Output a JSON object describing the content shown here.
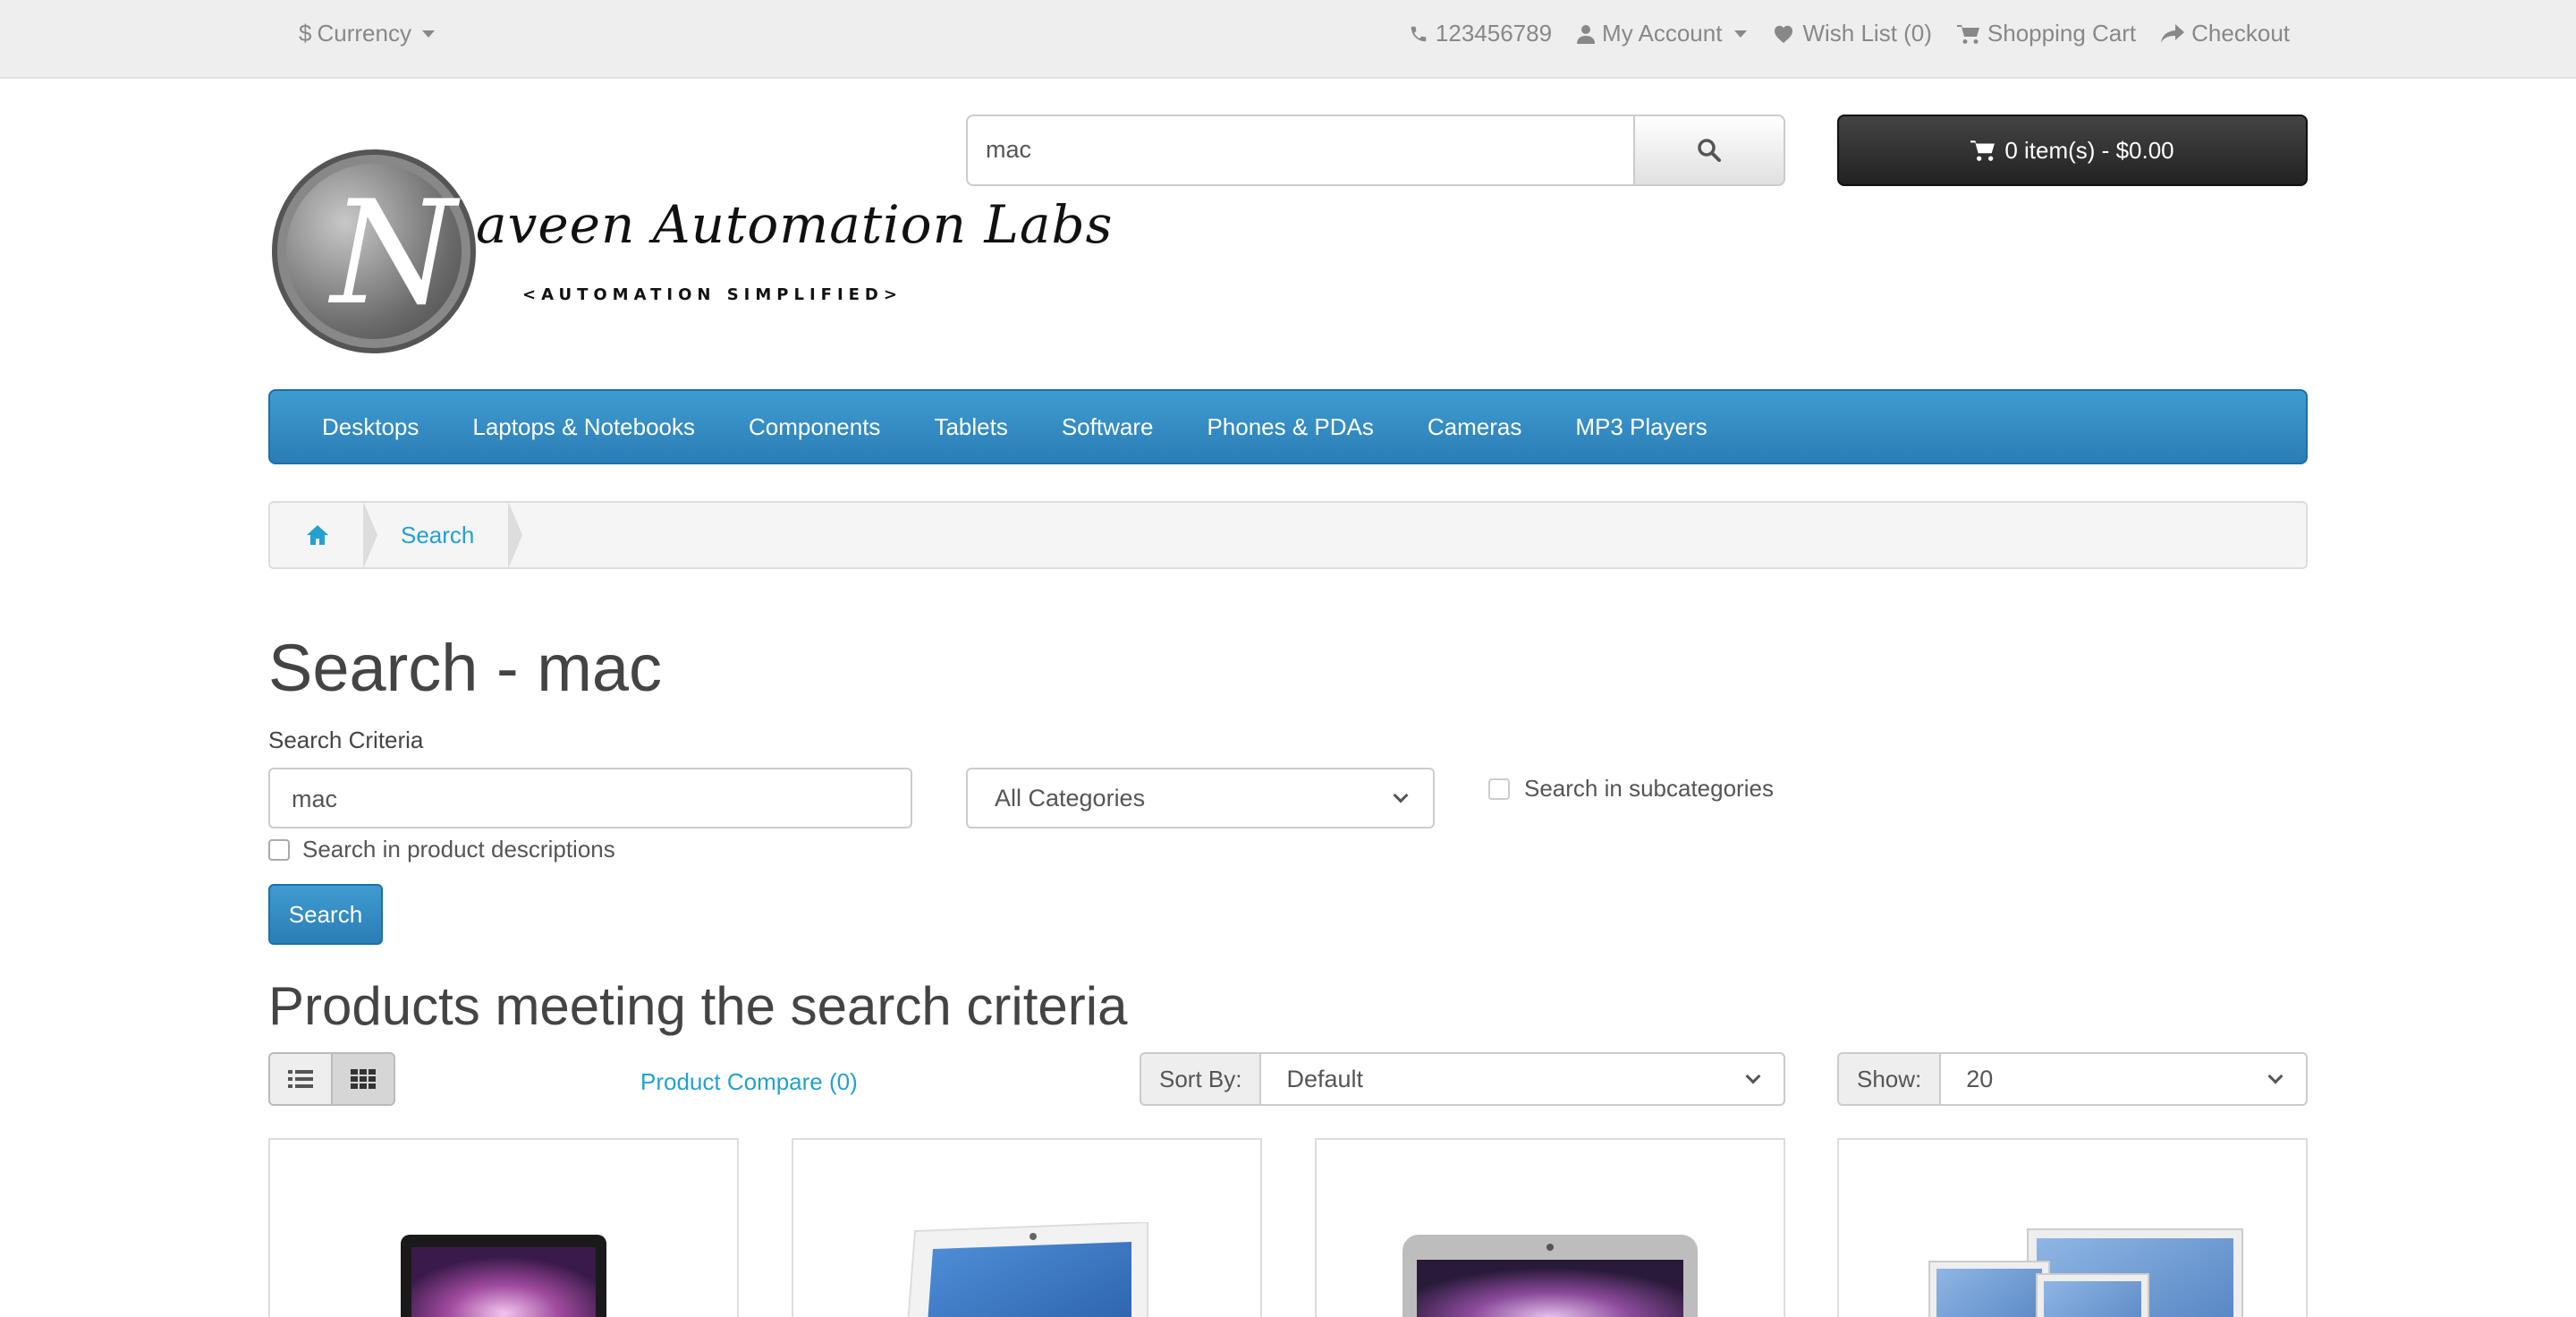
{
  "topbar": {
    "currency_label": "Currency",
    "phone": "123456789",
    "my_account": "My Account",
    "wish_list": "Wish List (0)",
    "shopping_cart": "Shopping Cart",
    "checkout": "Checkout"
  },
  "logo": {
    "wordmark": "aveen Automation Labs",
    "tagline": "<AUTOMATION SIMPLIFIED>",
    "initial": "N"
  },
  "header_search": {
    "value": "mac"
  },
  "cart": {
    "label": "0 item(s) - $0.00"
  },
  "menu": {
    "items": [
      "Desktops",
      "Laptops & Notebooks",
      "Components",
      "Tablets",
      "Software",
      "Phones & PDAs",
      "Cameras",
      "MP3 Players"
    ]
  },
  "breadcrumb": {
    "items": [
      "Search"
    ]
  },
  "page": {
    "title": "Search - mac",
    "criteria_label": "Search Criteria",
    "criteria_value": "mac",
    "category_selected": "All Categories",
    "subcategories_label": "Search in subcategories",
    "descriptions_label": "Search in product descriptions",
    "search_button": "Search",
    "results_heading": "Products meeting the search criteria",
    "product_compare": "Product Compare (0)",
    "sort_label": "Sort By:",
    "sort_value": "Default",
    "show_label": "Show:",
    "show_value": "20"
  },
  "colors": {
    "accent": "#2a7db5",
    "link": "#23a1d1",
    "cart_bg": "#222222"
  }
}
